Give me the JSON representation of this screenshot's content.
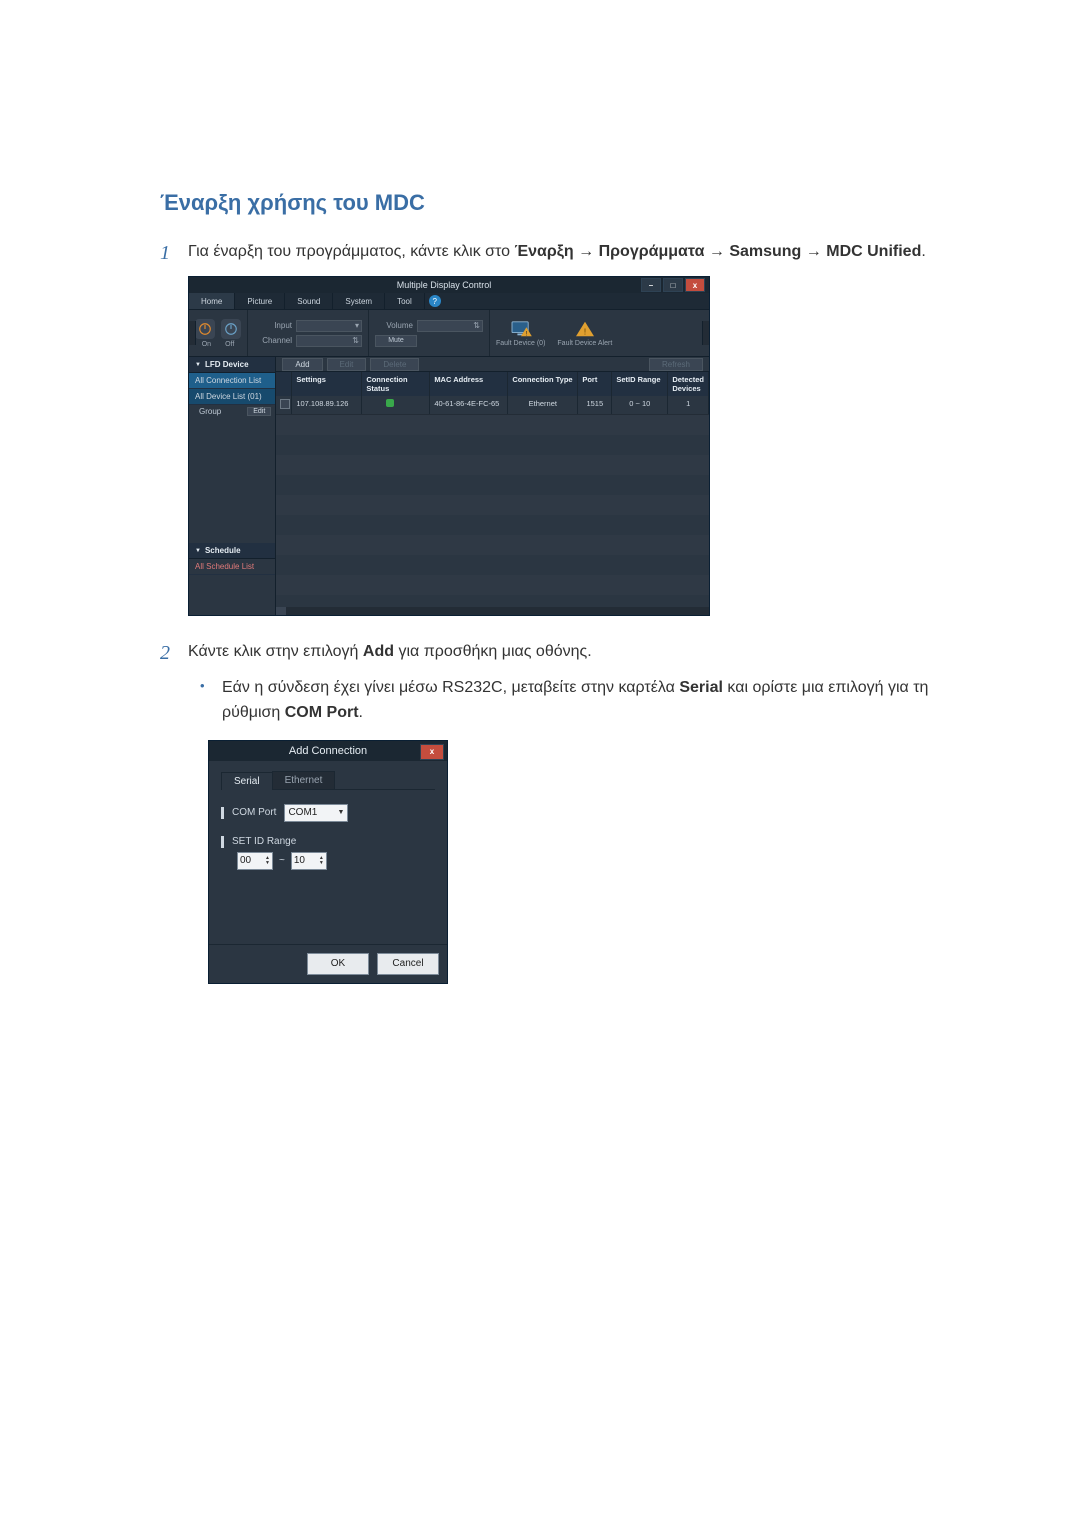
{
  "heading": "Έναρξη χρήσης του MDC",
  "steps": {
    "s1_num": "1",
    "s1_a": "Για έναρξη του προγράμματος, κάντε κλικ στο ",
    "s1_b1": "Έναρξη",
    "s1_b2": "Προγράμματα",
    "s1_b3": "Samsung",
    "s1_b4": "MDC Unified",
    "arrow": " → ",
    "period": ".",
    "s2_num": "2",
    "s2_a": "Κάντε κλικ στην επιλογή ",
    "s2_b": "Add",
    "s2_c": " για προσθήκη μιας οθόνης.",
    "bullet_a": "Εάν η σύνδεση έχει γίνει μέσω RS232C, μεταβείτε στην καρτέλα ",
    "bullet_b": "Serial",
    "bullet_c": " και ορίστε μια επιλογή για τη ρύθμιση ",
    "bullet_d": "COM Port",
    "bullet_dot": "•"
  },
  "mdc": {
    "title": "Multiple Display Control",
    "tabs": {
      "home": "Home",
      "picture": "Picture",
      "sound": "Sound",
      "system": "System",
      "tool": "Tool"
    },
    "ribbon": {
      "on": "On",
      "off": "Off",
      "input": "Input",
      "channel": "Channel",
      "volume": "Volume",
      "mute": "Mute",
      "fault_zero": "Fault Device (0)",
      "fault_alert": "Fault Device Alert"
    },
    "sidebar": {
      "lfd": "LFD Device",
      "all_conn": "All Connection List",
      "all_dev": "All Device List (01)",
      "group": "Group",
      "edit_btn": "Edit",
      "schedule": "Schedule",
      "all_sched": "All Schedule List"
    },
    "toolbar": {
      "add": "Add",
      "edit": "Edit",
      "delete": "Delete",
      "refresh": "Refresh"
    },
    "columns": {
      "settings": "Settings",
      "status": "Connection Status",
      "mac": "MAC Address",
      "conn_type": "Connection Type",
      "port": "Port",
      "range": "SetID Range",
      "detected": "Detected Devices"
    },
    "row": {
      "settings": "107.108.89.126",
      "mac": "40-61-86-4E-FC-65",
      "conn_type": "Ethernet",
      "port": "1515",
      "range": "0 ~ 10",
      "detected": "1"
    }
  },
  "addconn": {
    "title": "Add Connection",
    "tab_serial": "Serial",
    "tab_eth": "Ethernet",
    "com_port_label": "COM Port",
    "com_port_value": "COM1",
    "setid_label": "SET ID Range",
    "range_from": "00",
    "range_to": "10",
    "tilde": "~",
    "ok": "OK",
    "cancel": "Cancel"
  }
}
